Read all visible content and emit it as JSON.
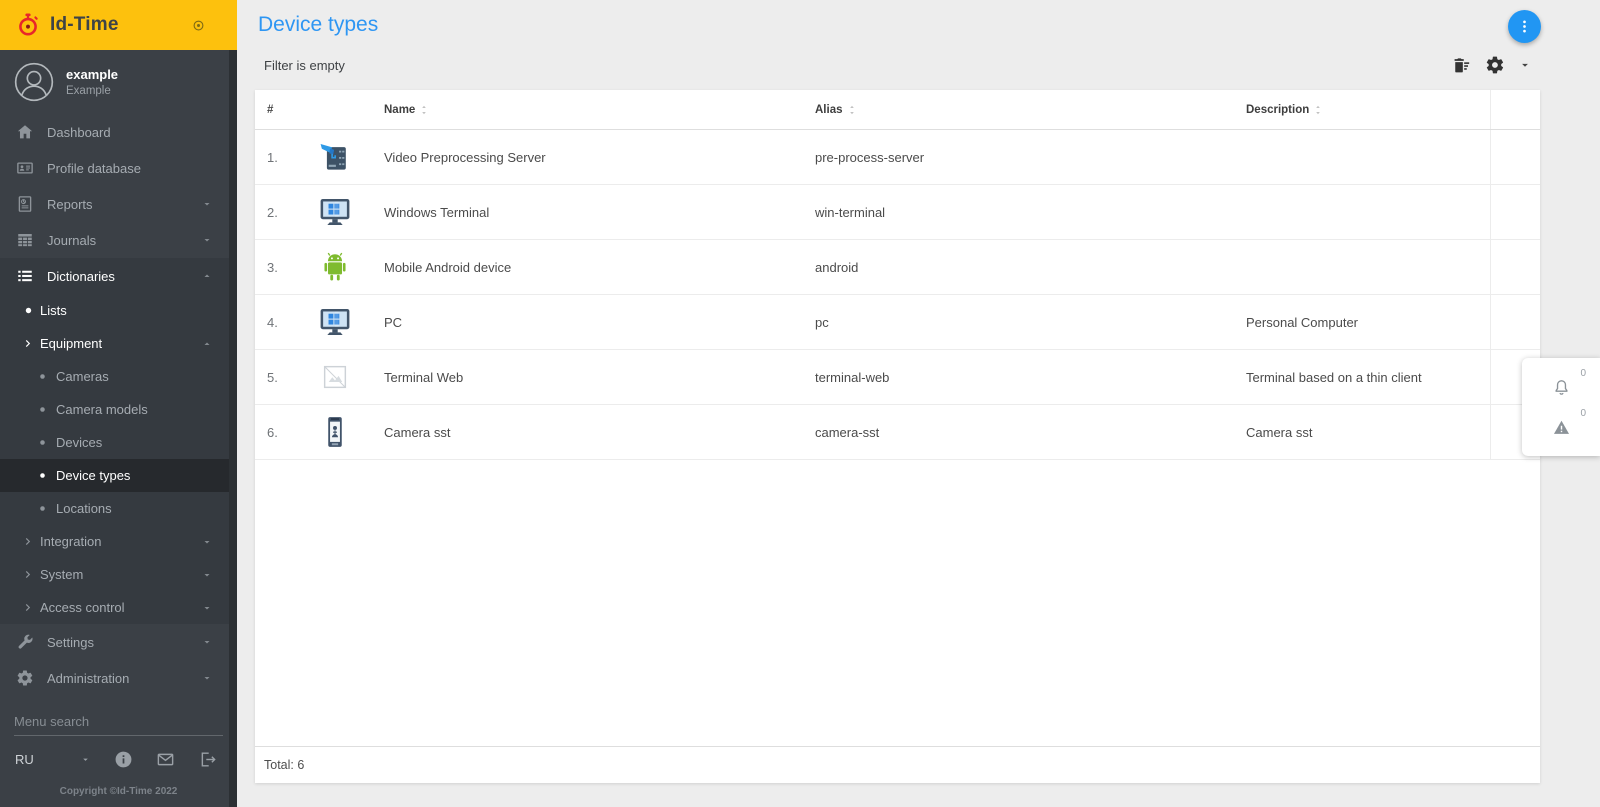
{
  "app": {
    "brand": "Id-Time",
    "language": "RU",
    "copyright": "Copyright ©Id-Time 2022"
  },
  "user": {
    "name": "example",
    "role": "Example"
  },
  "sidebar": {
    "search_placeholder": "Menu search",
    "items": [
      {
        "id": "dashboard",
        "label": "Dashboard",
        "icon": "home",
        "level": 0
      },
      {
        "id": "profile-database",
        "label": "Profile database",
        "icon": "id-card",
        "level": 0
      },
      {
        "id": "reports",
        "label": "Reports",
        "icon": "report",
        "level": 0,
        "caret": "down"
      },
      {
        "id": "journals",
        "label": "Journals",
        "icon": "grid",
        "level": 0,
        "caret": "down"
      },
      {
        "id": "dictionaries",
        "label": "Dictionaries",
        "icon": "list",
        "level": 0,
        "caret": "up",
        "white": true,
        "section": true
      },
      {
        "id": "lists",
        "label": "Lists",
        "icon": "bullet",
        "level": 1,
        "white": true,
        "section": true
      },
      {
        "id": "equipment",
        "label": "Equipment",
        "icon": "chevron-right",
        "level": 1,
        "caret": "up",
        "white": true,
        "section": true
      },
      {
        "id": "cameras",
        "label": "Cameras",
        "icon": "bullet",
        "level": 2,
        "section": true
      },
      {
        "id": "camera-models",
        "label": "Camera models",
        "icon": "bullet",
        "level": 2,
        "section": true
      },
      {
        "id": "devices",
        "label": "Devices",
        "icon": "bullet",
        "level": 2,
        "section": true
      },
      {
        "id": "device-types",
        "label": "Device types",
        "icon": "bullet",
        "level": 2,
        "white": true,
        "selected": true,
        "section": true
      },
      {
        "id": "locations",
        "label": "Locations",
        "icon": "bullet",
        "level": 2,
        "section": true
      },
      {
        "id": "integration",
        "label": "Integration",
        "icon": "chevron-right",
        "level": 1,
        "caret": "down",
        "section": true
      },
      {
        "id": "system",
        "label": "System",
        "icon": "chevron-right",
        "level": 1,
        "caret": "down",
        "section": true
      },
      {
        "id": "access-control",
        "label": "Access control",
        "icon": "chevron-right",
        "level": 1,
        "caret": "down",
        "section": true
      },
      {
        "id": "settings",
        "label": "Settings",
        "icon": "wrench",
        "level": 0,
        "caret": "down"
      },
      {
        "id": "administration",
        "label": "Administration",
        "icon": "gear",
        "level": 0,
        "caret": "down"
      }
    ]
  },
  "page": {
    "title": "Device types",
    "filter_status": "Filter is empty",
    "total": "Total: 6"
  },
  "table": {
    "columns": [
      {
        "label": "#",
        "sortable": false
      },
      {
        "label": "Name",
        "sortable": true
      },
      {
        "label": "Alias",
        "sortable": true
      },
      {
        "label": "Description",
        "sortable": true
      }
    ],
    "rows": [
      {
        "num": "1.",
        "icon": "server-camera",
        "name": "Video Preprocessing Server",
        "alias": "pre-process-server",
        "description": ""
      },
      {
        "num": "2.",
        "icon": "monitor-windows",
        "name": "Windows Terminal",
        "alias": "win-terminal",
        "description": ""
      },
      {
        "num": "3.",
        "icon": "android-robot",
        "name": "Mobile Android device",
        "alias": "android",
        "description": ""
      },
      {
        "num": "4.",
        "icon": "monitor-windows",
        "name": "PC",
        "alias": "pc",
        "description": "Personal Computer"
      },
      {
        "num": "5.",
        "icon": "broken-image",
        "name": "Terminal Web",
        "alias": "terminal-web",
        "description": "Terminal based on a thin client"
      },
      {
        "num": "6.",
        "icon": "kiosk-camera",
        "name": "Camera sst",
        "alias": "camera-sst",
        "description": "Camera sst"
      }
    ]
  },
  "notifications": {
    "bell_count": "0",
    "warning_count": "0"
  },
  "colors": {
    "brand_yellow": "#fdc10d",
    "accent_blue": "#2e96f3",
    "fab_blue": "#2196f3",
    "logo_red": "#e8262a",
    "sidebar_bg": "#3b4046",
    "sidebar_section_bg": "#353a40",
    "sidebar_active_bg": "#26292d",
    "android_green": "#7fbb2f"
  }
}
